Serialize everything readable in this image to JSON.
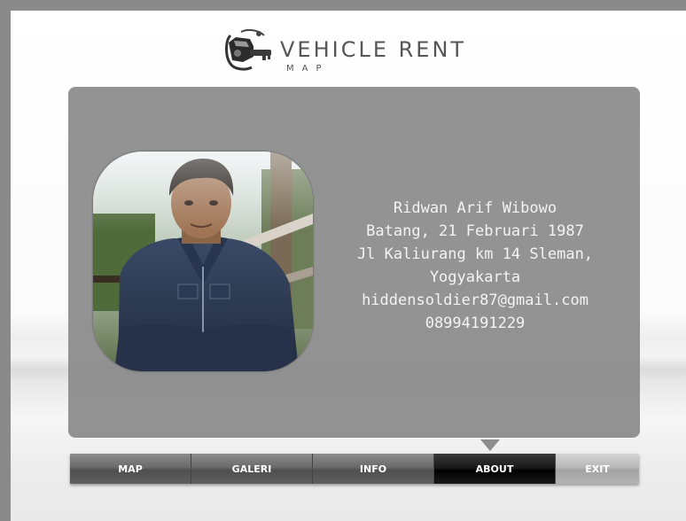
{
  "app": {
    "title": "VEHICLE RENT",
    "subtitle": "MAP"
  },
  "profile": {
    "name": "Ridwan Arif Wibowo",
    "birth": "Batang, 21 Februari 1987",
    "address_line1": "Jl Kaliurang km 14 Sleman,",
    "address_line2": "Yogyakarta",
    "email": "hiddensoldier87@gmail.com",
    "phone": "08994191229"
  },
  "nav": {
    "items": [
      {
        "label": "MAP"
      },
      {
        "label": "GALERI"
      },
      {
        "label": "INFO"
      },
      {
        "label": "ABOUT",
        "active": true
      },
      {
        "label": "EXIT"
      }
    ]
  },
  "colors": {
    "panel": "#878787",
    "nav_active": "#000000",
    "nav_default": "#5e5e5e",
    "nav_exit": "#b4b4b4"
  }
}
